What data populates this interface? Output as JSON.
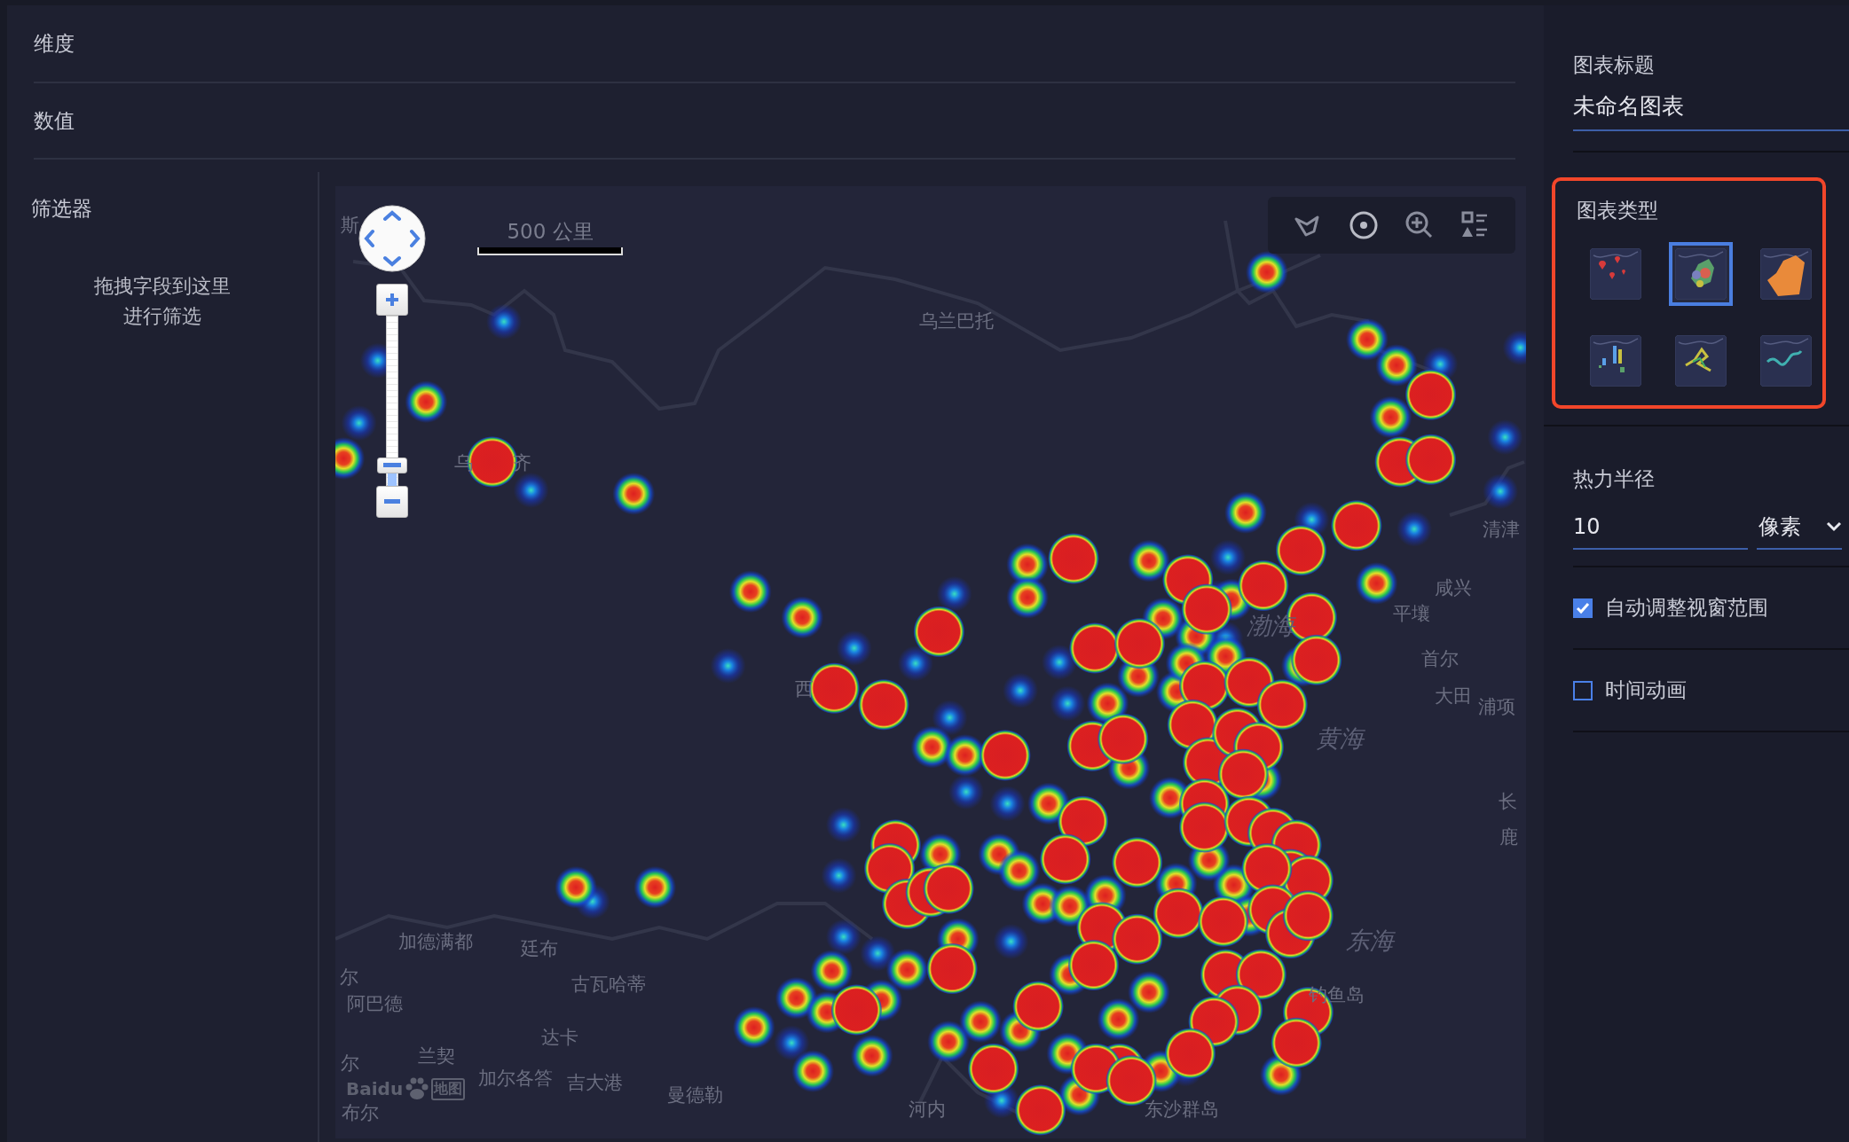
{
  "fields": [
    {
      "label": "维度"
    },
    {
      "label": "数值"
    }
  ],
  "filter": {
    "title": "筛选器",
    "hint_lines": [
      "拖拽字段到这里",
      "进行筛选"
    ]
  },
  "map": {
    "scale_label": "500 公里",
    "zoom_slider": {
      "level": 0.12
    },
    "logo_text": "Baidu",
    "logo_suffix": "地图",
    "labels": [
      {
        "text": "斯",
        "kind": "city"
      },
      {
        "text": "乌兰巴托",
        "kind": "city"
      },
      {
        "text": "乌",
        "kind": "city"
      },
      {
        "text": "齐",
        "kind": "city"
      },
      {
        "text": "清津",
        "kind": "city"
      },
      {
        "text": "咸兴",
        "kind": "city"
      },
      {
        "text": "平壤",
        "kind": "city"
      },
      {
        "text": "渤海",
        "kind": "sea"
      },
      {
        "text": "首尔",
        "kind": "city"
      },
      {
        "text": "西",
        "kind": "city"
      },
      {
        "text": "大田",
        "kind": "city"
      },
      {
        "text": "浦项",
        "kind": "city"
      },
      {
        "text": "黄海",
        "kind": "sea"
      },
      {
        "text": "长",
        "kind": "city"
      },
      {
        "text": "鹿",
        "kind": "city"
      },
      {
        "text": "加德满都",
        "kind": "city"
      },
      {
        "text": "廷布",
        "kind": "city"
      },
      {
        "text": "东海",
        "kind": "sea"
      },
      {
        "text": "尔",
        "kind": "city"
      },
      {
        "text": "古瓦哈蒂",
        "kind": "city"
      },
      {
        "text": "钓鱼岛",
        "kind": "city"
      },
      {
        "text": "阿巴德",
        "kind": "city"
      },
      {
        "text": "达卡",
        "kind": "city"
      },
      {
        "text": "兰契",
        "kind": "city"
      },
      {
        "text": "尔",
        "kind": "city"
      },
      {
        "text": "加尔各答",
        "kind": "city"
      },
      {
        "text": "吉大港",
        "kind": "city"
      },
      {
        "text": "曼德勒",
        "kind": "city"
      },
      {
        "text": "布尔",
        "kind": "city"
      },
      {
        "text": "河内",
        "kind": "city"
      },
      {
        "text": "东沙群岛",
        "kind": "city"
      }
    ]
  },
  "settings": {
    "title_label": "图表标题",
    "title_value": "未命名图表",
    "type_label": "图表类型",
    "type_highlighted": true,
    "chart_types": [
      {
        "kind": "marker",
        "selected": false
      },
      {
        "kind": "heat",
        "selected": true
      },
      {
        "kind": "scatter",
        "selected": false
      },
      {
        "kind": "column",
        "selected": false
      },
      {
        "kind": "trajectory",
        "selected": false
      },
      {
        "kind": "line",
        "selected": false
      }
    ],
    "radius_label": "热力半径",
    "radius_value": "10",
    "radius_unit": "像素",
    "options": [
      {
        "label": "自动调整视窗范围",
        "checked": true
      },
      {
        "label": "时间动画",
        "checked": false
      }
    ]
  }
}
